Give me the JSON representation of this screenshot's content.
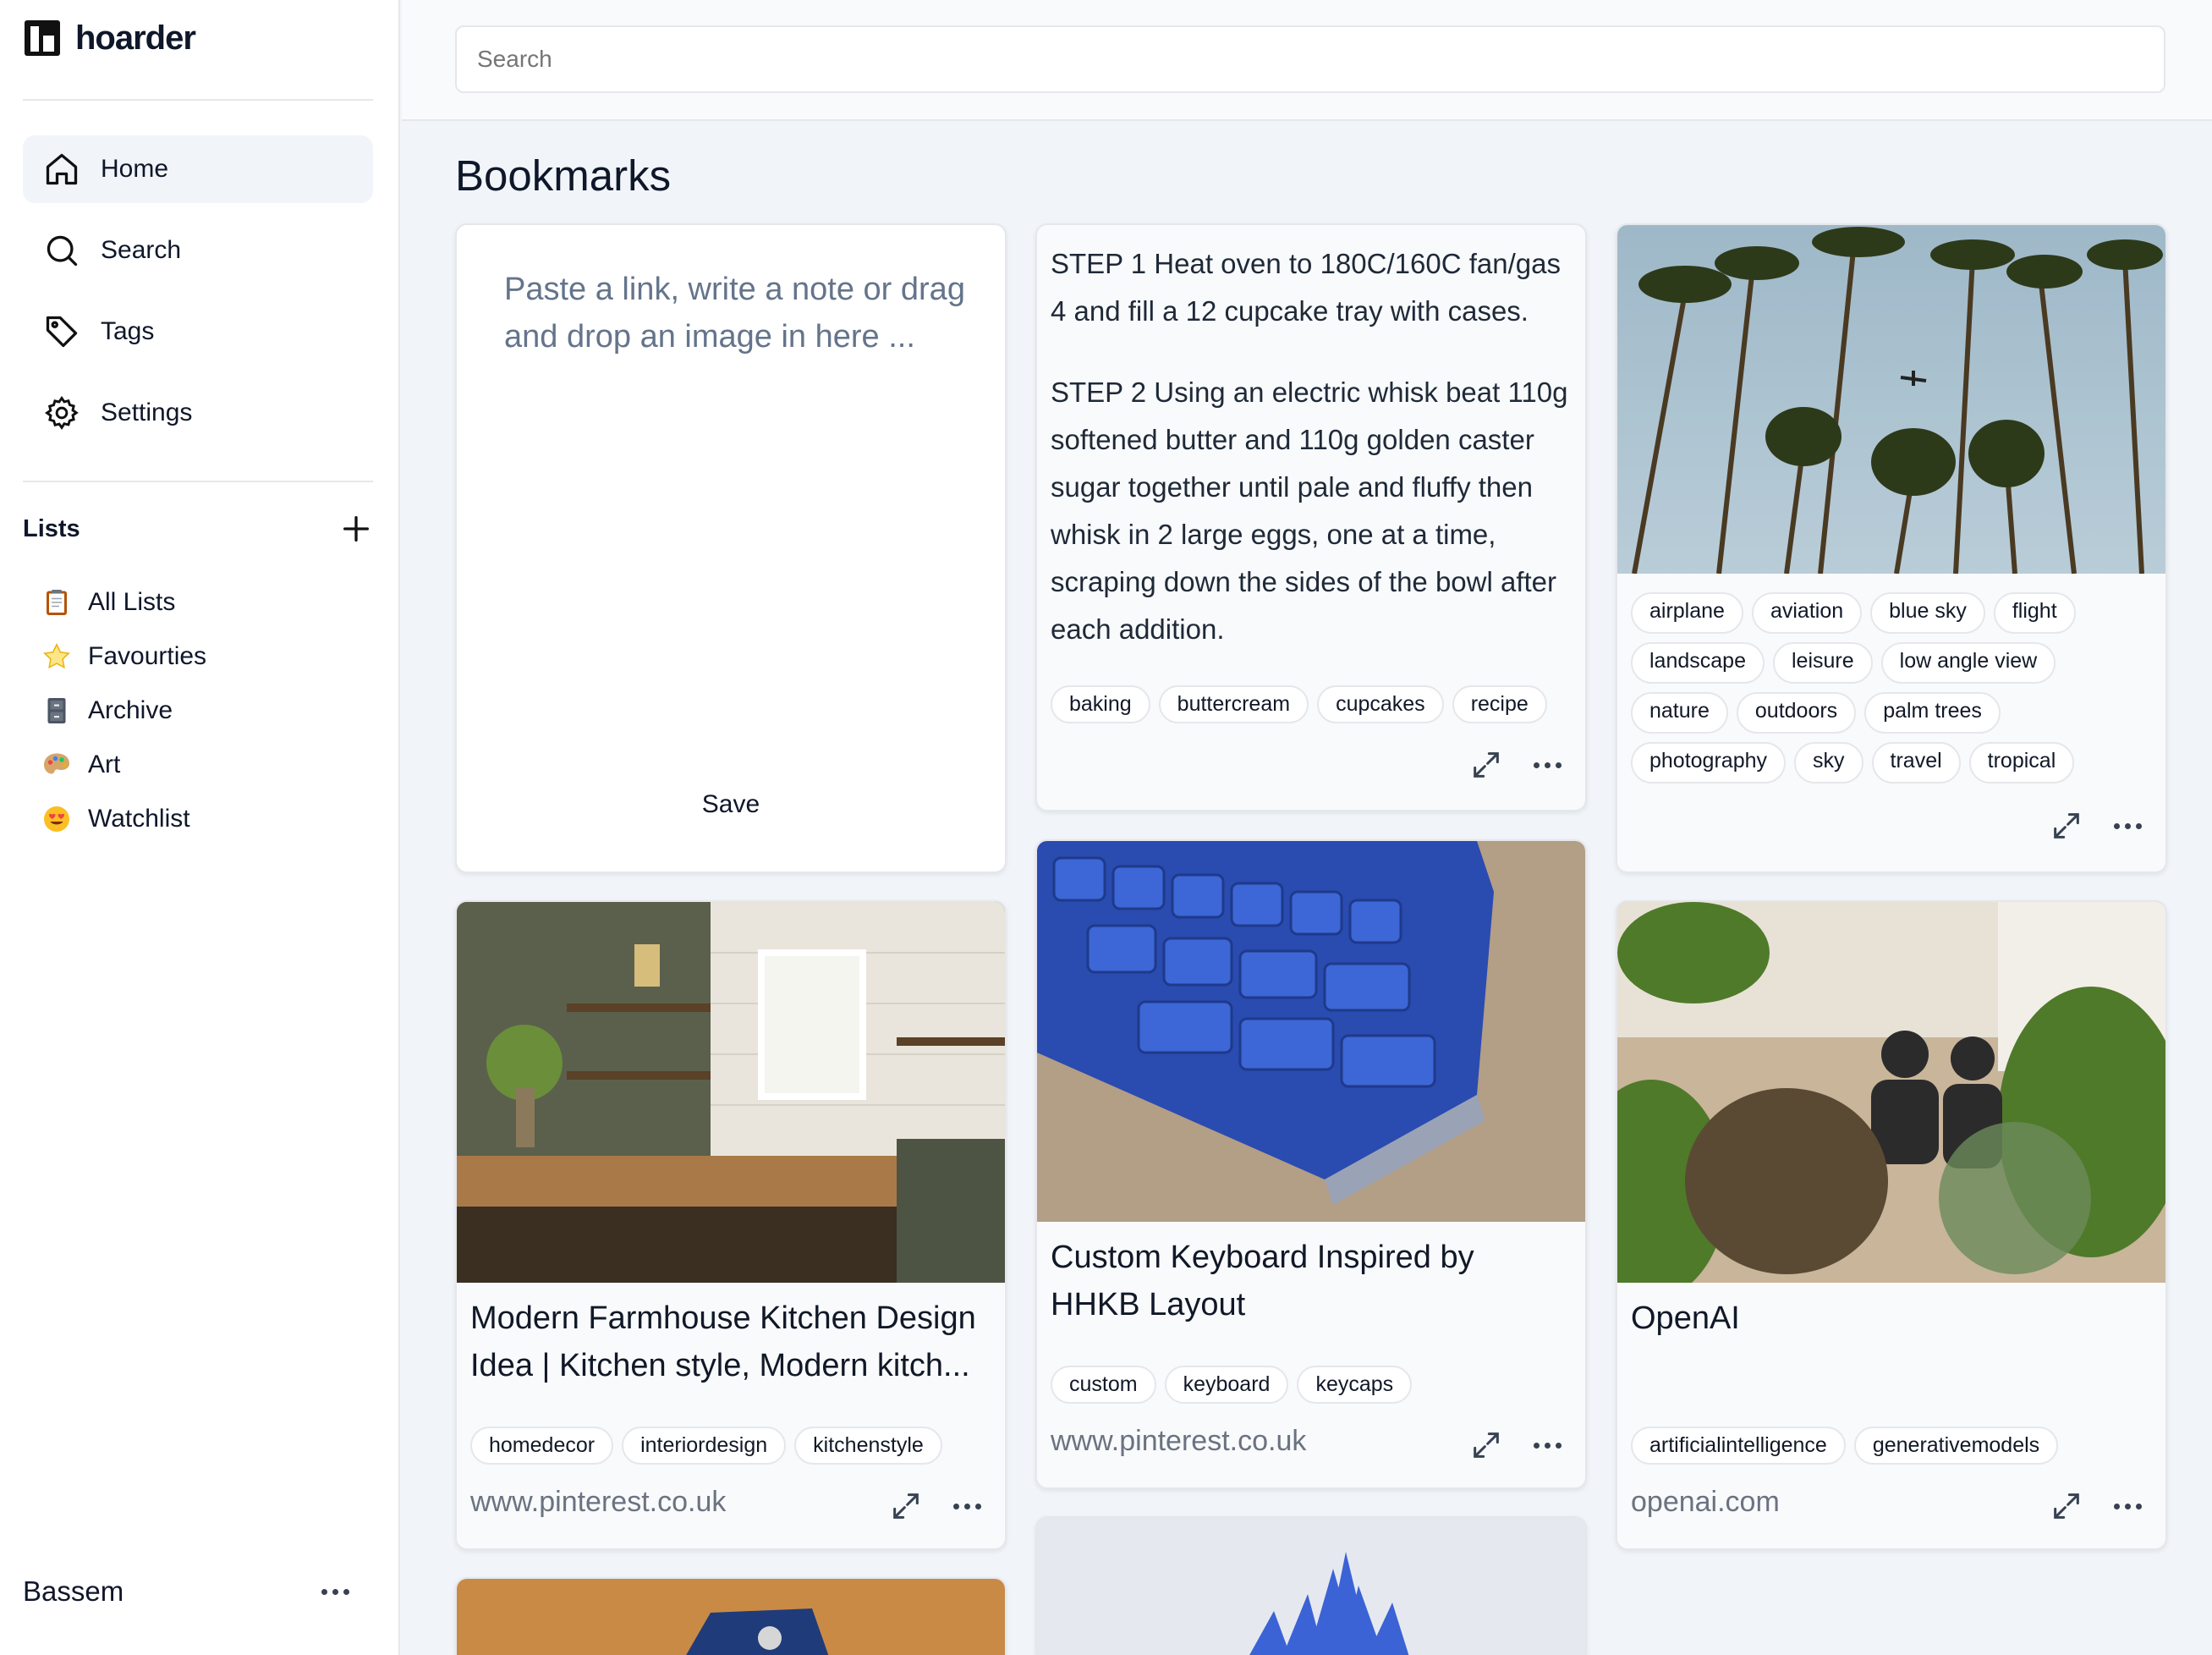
{
  "app": {
    "name": "hoarder"
  },
  "nav": [
    {
      "label": "Home",
      "icon": "home-icon",
      "active": true
    },
    {
      "label": "Search",
      "icon": "search-icon",
      "active": false
    },
    {
      "label": "Tags",
      "icon": "tag-icon",
      "active": false
    },
    {
      "label": "Settings",
      "icon": "gear-icon",
      "active": false
    }
  ],
  "lists": {
    "title": "Lists",
    "items": [
      {
        "emoji": "📋",
        "label": "All Lists"
      },
      {
        "emoji": "⭐",
        "label": "Favourties"
      },
      {
        "emoji": "🗄️",
        "label": "Archive"
      },
      {
        "emoji": "🎨",
        "label": "Art"
      },
      {
        "emoji": "😍",
        "label": "Watchlist"
      }
    ]
  },
  "user": {
    "name": "Bassem"
  },
  "search": {
    "placeholder": "Search"
  },
  "page": {
    "title": "Bookmarks"
  },
  "editor": {
    "placeholder": "Paste a link, write a note or drag and drop an image in here ...",
    "save_label": "Save"
  },
  "cards": {
    "recipe": {
      "step1": "STEP 1 Heat oven to 180C/160C fan/gas 4 and fill a 12 cupcake tray with cases.",
      "step2": "STEP 2 Using an electric whisk beat 110g softened butter and 110g golden caster sugar together until pale and fluffy then whisk in 2 large eggs, one at a time, scraping down the sides of the bowl after each addition.",
      "tags": [
        "baking",
        "buttercream",
        "cupcakes",
        "recipe"
      ]
    },
    "palms": {
      "tags": [
        "airplane",
        "aviation",
        "blue sky",
        "flight",
        "landscape",
        "leisure",
        "low angle view",
        "nature",
        "outdoors",
        "palm trees",
        "photography",
        "sky",
        "travel",
        "tropical"
      ]
    },
    "kitchen": {
      "title": "Modern Farmhouse Kitchen Design Idea | Kitchen style, Modern kitch...",
      "tags": [
        "homedecor",
        "interiordesign",
        "kitchenstyle"
      ],
      "domain": "www.pinterest.co.uk"
    },
    "keyboard": {
      "title": "Custom Keyboard Inspired by HHKB Layout",
      "tags": [
        "custom",
        "keyboard",
        "keycaps"
      ],
      "domain": "www.pinterest.co.uk"
    },
    "openai": {
      "title": "OpenAI",
      "tags": [
        "artificialintelligence",
        "generativemodels"
      ],
      "domain": "openai.com"
    }
  }
}
